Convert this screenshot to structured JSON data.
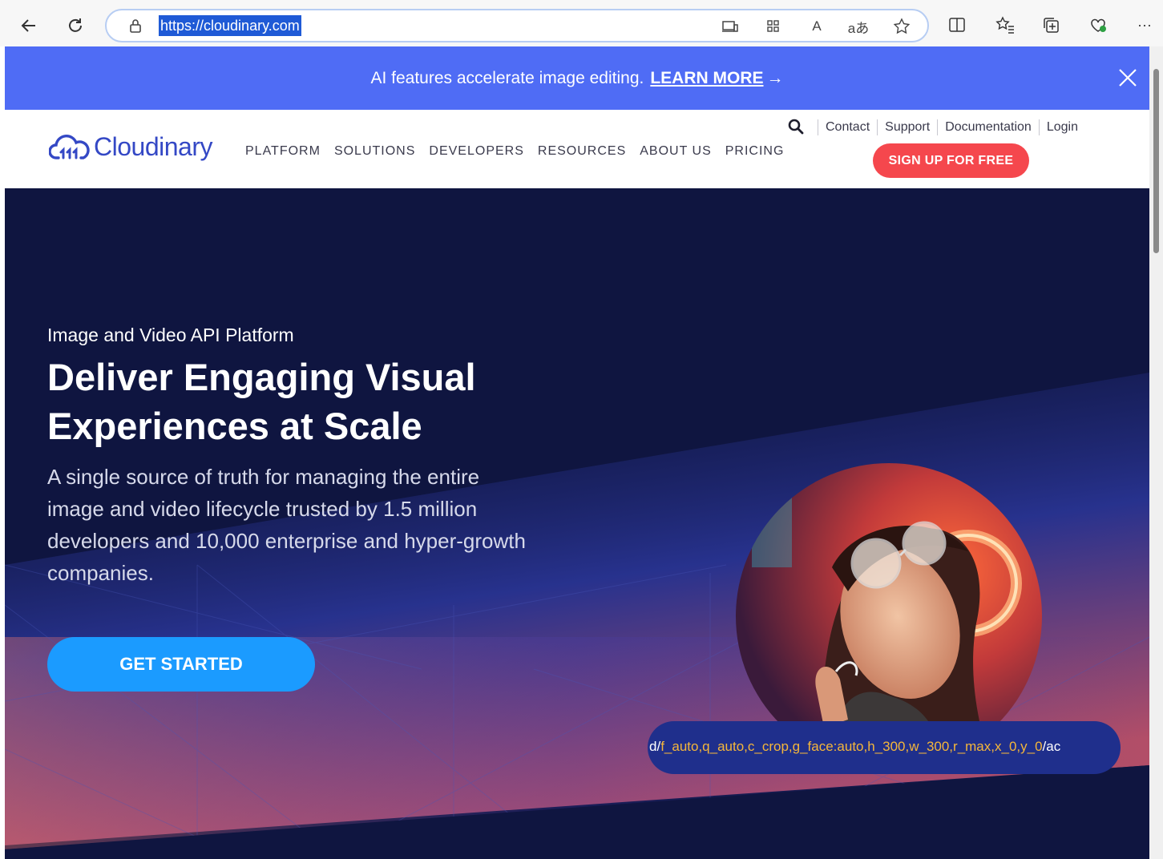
{
  "browser": {
    "url": "https://cloudinary.com",
    "back_icon": "arrow-left-icon",
    "refresh_icon": "refresh-icon",
    "read_aloud_label": "A",
    "translate_label": "aあ",
    "more_label": "···"
  },
  "announcement": {
    "text": "AI features accelerate image editing.",
    "link_label": "LEARN MORE",
    "arrow": "→"
  },
  "header": {
    "logo_text": "Cloudinary",
    "nav": [
      "PLATFORM",
      "SOLUTIONS",
      "DEVELOPERS",
      "RESOURCES",
      "ABOUT US",
      "PRICING"
    ],
    "util_nav": [
      "Contact",
      "Support",
      "Documentation",
      "Login"
    ],
    "signup_label": "SIGN UP FOR FREE"
  },
  "hero": {
    "eyebrow": "Image and Video API Platform",
    "title_line1": "Deliver Engaging Visual",
    "title_line2": "Experiences at Scale",
    "lead": "A single source of truth for managing the entire image and video lifecycle trusted by 1.5 million developers and 10,000 enterprise and hyper-growth companies.",
    "cta_label": "GET STARTED",
    "transform_url": {
      "prefix": "d/",
      "params": "f_auto,q_auto,c_crop,g_face:auto,h_300,w_300,r_max,x_0,y_0",
      "suffix": "/ac"
    }
  },
  "colors": {
    "announce_bg": "#4f6cf5",
    "brand_blue": "#3448c5",
    "signup_red": "#f5474d",
    "hero_bg": "#0f1540",
    "cta_blue": "#1b9bff",
    "url_orange": "#f4b63b"
  }
}
